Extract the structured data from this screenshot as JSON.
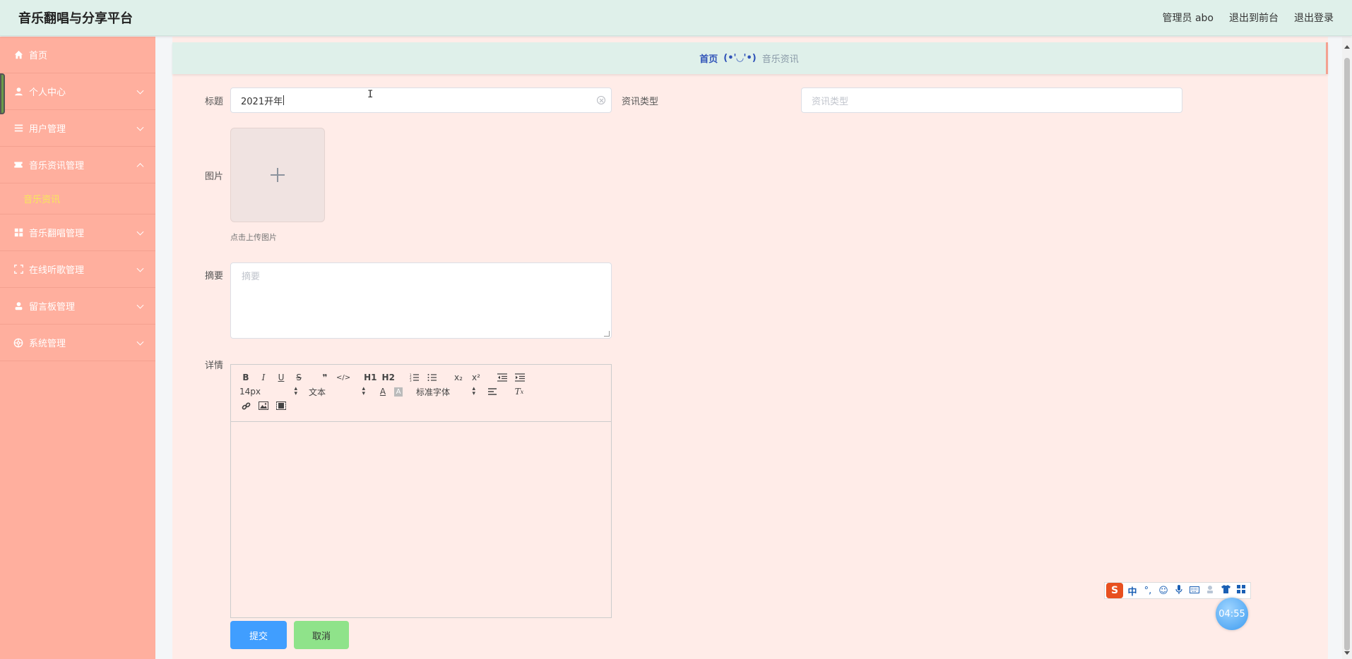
{
  "app": {
    "title": "音乐翻唱与分享平台"
  },
  "header": {
    "user": "管理员 abo",
    "to_front": "退出到前台",
    "logout": "退出登录"
  },
  "sidebar": {
    "items": [
      {
        "label": "首页",
        "icon": "home-icon"
      },
      {
        "label": "个人中心",
        "icon": "user-icon"
      },
      {
        "label": "用户管理",
        "icon": "list-icon"
      },
      {
        "label": "音乐资讯管理",
        "icon": "ticket-icon"
      },
      {
        "label": "音乐翻唱管理",
        "icon": "grid-icon"
      },
      {
        "label": "在线听歌管理",
        "icon": "fullscreen-icon"
      },
      {
        "label": "留言板管理",
        "icon": "person-icon"
      },
      {
        "label": "系统管理",
        "icon": "settings-icon"
      }
    ],
    "active_sub": "音乐资讯"
  },
  "breadcrumb": {
    "home": "首页",
    "separator": "(•'◡'•)",
    "current": "音乐资讯"
  },
  "form": {
    "title_label": "标题",
    "title_value": "2021开年",
    "type_label": "资讯类型",
    "type_placeholder": "资讯类型",
    "image_label": "图片",
    "upload_hint": "点击上传图片",
    "summary_label": "摘要",
    "summary_placeholder": "摘要",
    "detail_label": "详情",
    "submit": "提交",
    "cancel": "取消"
  },
  "editor": {
    "font_size": "14px",
    "heading": "文本",
    "font_family": "标准字体",
    "buttons_row1": [
      "B",
      "I",
      "U",
      "S",
      "❞",
      "</>",
      "H1",
      "H2",
      "ol",
      "ul",
      "x₂",
      "x²",
      "outdent",
      "indent"
    ]
  },
  "ime": {
    "mode": "中",
    "clock": "04:55"
  },
  "colors": {
    "sidebar_bg": "#ffaf9e",
    "topbar_bg": "#dff0ea",
    "main_bg": "#ffece8",
    "submit": "#409eff",
    "cancel": "#8fe38a",
    "active_sub": "#f7e85a"
  }
}
